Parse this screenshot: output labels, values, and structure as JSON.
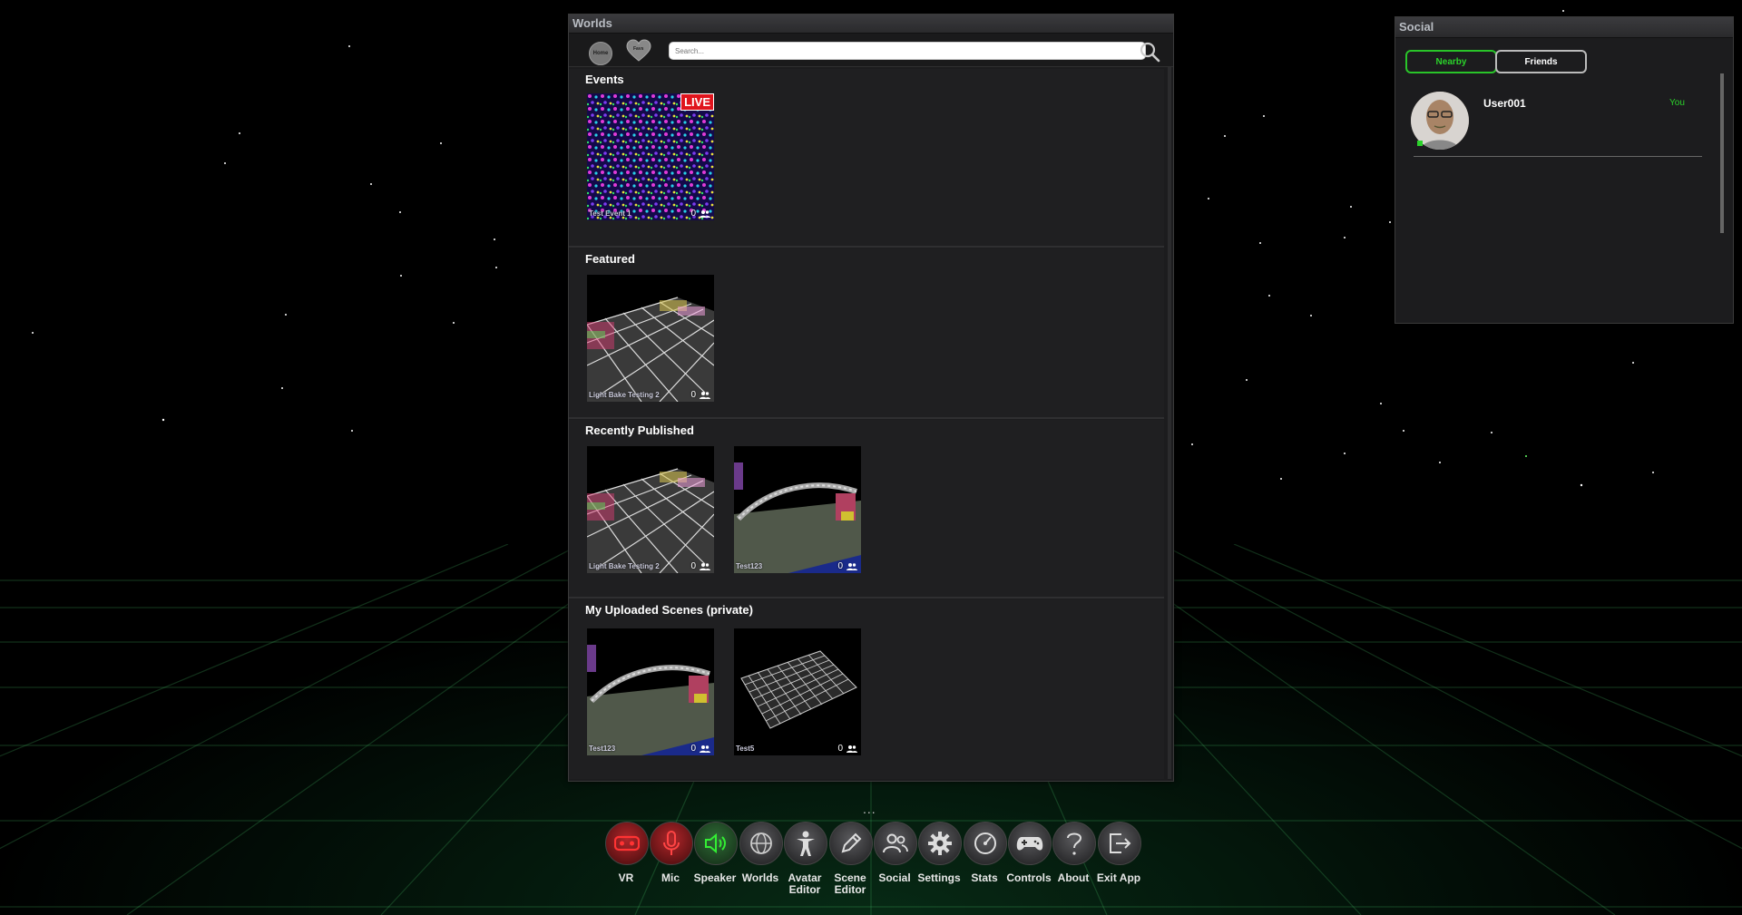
{
  "worlds_panel": {
    "title": "Worlds",
    "home_label": "Home",
    "favs_label": "Favs",
    "search_placeholder": "Search...",
    "sections": [
      {
        "title": "Events",
        "items": [
          {
            "name": "Test Event 1",
            "count": "0",
            "live": "LIVE"
          }
        ]
      },
      {
        "title": "Featured",
        "items": [
          {
            "name": "Light Bake Testing 2",
            "count": "0"
          }
        ]
      },
      {
        "title": "Recently Published",
        "items": [
          {
            "name": "Light Bake Testing 2",
            "count": "0"
          },
          {
            "name": "Test123",
            "count": "0"
          }
        ]
      },
      {
        "title": "My Uploaded Scenes (private)",
        "items": [
          {
            "name": "Test123",
            "count": "0"
          },
          {
            "name": "Test5",
            "count": "0"
          }
        ]
      }
    ]
  },
  "social_panel": {
    "title": "Social",
    "tabs": {
      "nearby": "Nearby",
      "friends": "Friends"
    },
    "users": [
      {
        "name": "User001",
        "tag": "You"
      }
    ],
    "accent": "#2bd22b"
  },
  "menu": {
    "more": "...",
    "items": [
      {
        "label": "VR",
        "icon": "vr-headset-icon"
      },
      {
        "label": "Mic",
        "icon": "microphone-icon"
      },
      {
        "label": "Speaker",
        "icon": "speaker-icon"
      },
      {
        "label": "Worlds",
        "icon": "globe-icon"
      },
      {
        "label": "Avatar Editor",
        "icon": "person-icon"
      },
      {
        "label": "Scene Editor",
        "icon": "pencil-icon"
      },
      {
        "label": "Social",
        "icon": "people-icon"
      },
      {
        "label": "Settings",
        "icon": "gear-icon"
      },
      {
        "label": "Stats",
        "icon": "gauge-icon"
      },
      {
        "label": "Controls",
        "icon": "gamepad-icon"
      },
      {
        "label": "About",
        "icon": "question-icon"
      },
      {
        "label": "Exit App",
        "icon": "exit-icon"
      }
    ]
  }
}
